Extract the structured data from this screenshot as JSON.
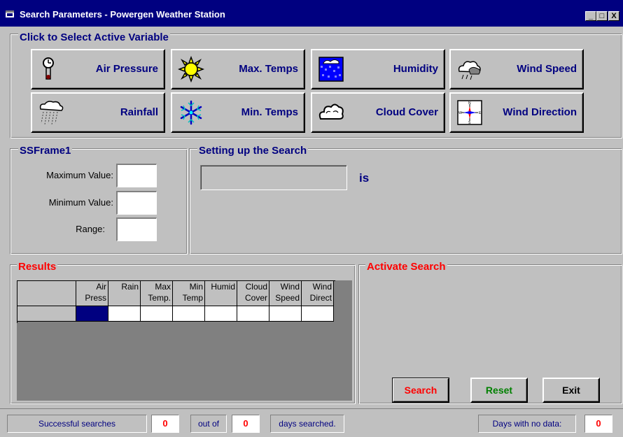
{
  "window": {
    "title": "Search Parameters - Powergen Weather Station",
    "controls": {
      "minimize": "_",
      "maximize": "□",
      "close": "X"
    }
  },
  "variables": {
    "legend": "Click to Select Active Variable",
    "buttons": [
      {
        "label": "Air Pressure",
        "icon": "barometer-clock-icon"
      },
      {
        "label": "Max. Temps",
        "icon": "sun-icon"
      },
      {
        "label": "Humidity",
        "icon": "humidity-icon"
      },
      {
        "label": "Wind Speed",
        "icon": "wind-cloud-icon"
      },
      {
        "label": "Rainfall",
        "icon": "rain-cloud-icon"
      },
      {
        "label": "Min. Temps",
        "icon": "snowflake-icon"
      },
      {
        "label": "Cloud Cover",
        "icon": "cloud-icon"
      },
      {
        "label": "Wind Direction",
        "icon": "compass-icon"
      }
    ]
  },
  "ssframe": {
    "legend": "SSFrame1",
    "max_label": "Maximum Value:",
    "max_value": "",
    "min_label": "Minimum Value:",
    "min_value": "",
    "range_label": "Range:",
    "range_value": ""
  },
  "setup": {
    "legend": "Setting up the Search",
    "operator_value": "",
    "is_label": "is"
  },
  "results": {
    "legend": "Results",
    "columns": [
      [
        "Air",
        "Press"
      ],
      [
        "Rain",
        ""
      ],
      [
        "Max",
        "Temp."
      ],
      [
        "Min",
        "Temp"
      ],
      [
        "Humid",
        ""
      ],
      [
        "Cloud",
        "Cover"
      ],
      [
        "Wind",
        "Speed"
      ],
      [
        "Wind",
        "Direct"
      ]
    ],
    "row": [
      "",
      "",
      "",
      "",
      "",
      "",
      "",
      ""
    ]
  },
  "activate": {
    "legend": "Activate Search",
    "search_label": "Search",
    "reset_label": "Reset",
    "exit_label": "Exit"
  },
  "status": {
    "successful_label": "Successful searches",
    "successful_count": "0",
    "out_of_label": "out of",
    "days_count": "0",
    "days_searched_label": "days searched.",
    "no_data_label": "Days with no data:",
    "no_data_count": "0"
  },
  "colors": {
    "title_bar": "#000080",
    "legend_navy": "#000080",
    "legend_red": "#ff0000",
    "search_text": "#ff0000",
    "reset_text": "#008000",
    "selected_cell": "#000080"
  }
}
